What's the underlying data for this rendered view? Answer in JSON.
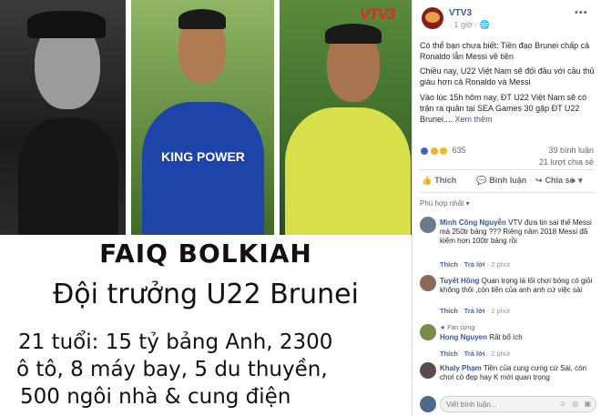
{
  "image": {
    "logo": "VTV3",
    "caption": {
      "name": "FAIQ BOLKIAH",
      "role": "Đội trưởng U22 Brunei",
      "line1": "21 tuổi: 15 tỷ bảng Anh, 2300",
      "line2": "ô tô, 8 máy bay, 5 du thuyền,",
      "line3": "500 ngôi nhà & cung điện"
    },
    "jersey_text": "KING POWER"
  },
  "post": {
    "page_name": "VTV3",
    "time": "· 1 giờ · ",
    "more": "•••",
    "paragraph1": "Có thể bạn chưa biết: Tiền đạo Brunei chấp cả Ronaldo lẫn Messi về tiền",
    "paragraph2": "Chiều nay, U22 Việt Nam sẽ đối đầu với cầu thủ giàu hơn cả Ronaldo và Messi",
    "paragraph3": "Vào lúc 15h hôm nay, ĐT U22 Việt Nam sẽ có trận ra quân tại SEA Games 30 gặp ĐT U22 Brunei....",
    "see_more": "Xem thêm",
    "reaction_count": "635",
    "comments_count": "39 bình luận",
    "shares_count": "21 lượt chia sẻ",
    "actions": {
      "like": "Thích",
      "comment": "Bình luận",
      "share": "Chia sẻ"
    },
    "sort_label": "Phù hợp nhất ▾"
  },
  "comments": [
    {
      "name": "Minh Công Nguyễn",
      "text": "VTV đưa tin sai thế Messi mà 250tr bảng ??? Riêng năm 2018 Messi đã kiếm hơn 100tr bảng rồi",
      "meta_like": "Thích",
      "meta_reply": "Trả lời",
      "meta_time": "· 2 phút"
    },
    {
      "name": "Tuyết Hồng",
      "text": "Quan trọng là lối chơi bóng có giỏi không thôi ,còn tiền của anh anh cứ việc sài",
      "meta_like": "Thích",
      "meta_reply": "Trả lời",
      "meta_time": "· 2 phút"
    },
    {
      "badge": "Fan cứng",
      "name": "Hong Nguyen",
      "text": "Rất bổ ích",
      "meta_like": "Thích",
      "meta_reply": "Trả lời",
      "meta_time": "· 2 phút"
    },
    {
      "name": "Khaly Phạm",
      "text": "Tiền của cung cưng cứ Sài, còn chơi có đẹp hay K mới quan trọng"
    }
  ],
  "composer": {
    "placeholder": "Viết bình luận..."
  },
  "colors": {
    "link": "#385898",
    "meta": "#90949c",
    "logo_red": "#e32626"
  }
}
